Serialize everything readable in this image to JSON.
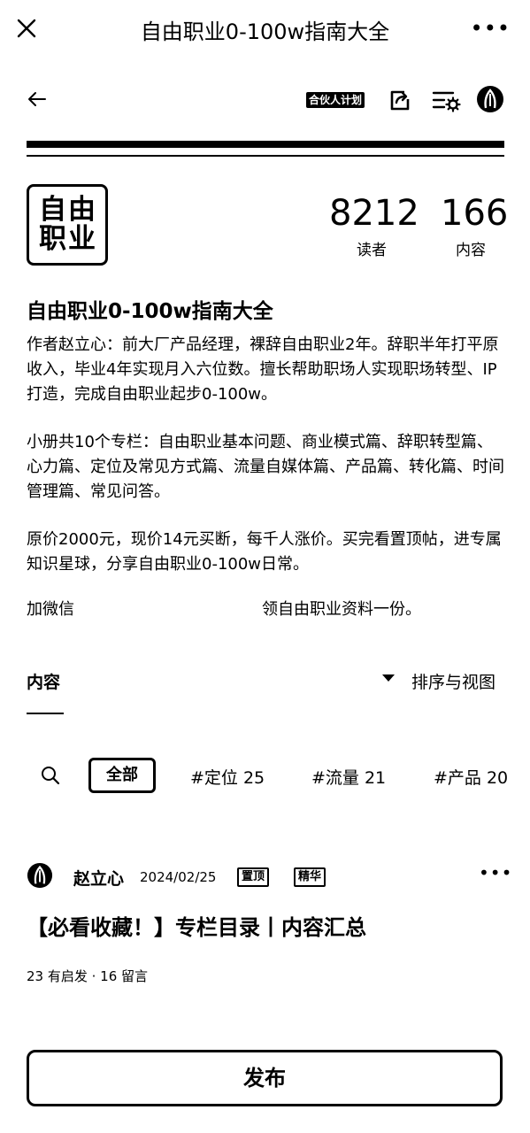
{
  "window": {
    "title": "自由职业0-100w指南大全"
  },
  "header": {
    "plan_badge": "合伙人计划"
  },
  "profile": {
    "logo_chars": [
      "自",
      "由",
      "职",
      "业"
    ],
    "readers_count": "8212",
    "readers_label": "读者",
    "content_count": "166",
    "content_label": "内容",
    "channel_title": "自由职业0-100w指南大全",
    "description_1": "作者赵立心：前大厂产品经理，裸辞自由职业2年。辞职半年打平原收入，毕业4年实现月入六位数。擅长帮助职场人实现职场转型、IP打造，完成自由职业起步0-100w。",
    "description_2": "小册共10个专栏：自由职业基本问题、商业模式篇、辞职转型篇、心力篇、定位及常见方式篇、流量自媒体篇、产品篇、转化篇、时间管理篇、常见问答。",
    "description_3": "原价2000元，现价14元买断，每千人涨价。买完看置顶帖，进专属知识星球，分享自由职业0-100w日常。",
    "wechat_prefix": "加微信",
    "wechat_suffix": "领自由职业资料一份。"
  },
  "content_section": {
    "title": "内容",
    "sort_label": "排序与视图",
    "tags": [
      "全部",
      "#定位 25",
      "#流量 21",
      "#产品 20"
    ]
  },
  "post": {
    "author": "赵立心",
    "date": "2024/02/25",
    "badge_pinned": "置顶",
    "badge_featured": "精华",
    "title": "【必看收藏！】专栏目录丨内容汇总",
    "meta": "23 有启发 · 16 留言"
  },
  "publish_button": "发布"
}
